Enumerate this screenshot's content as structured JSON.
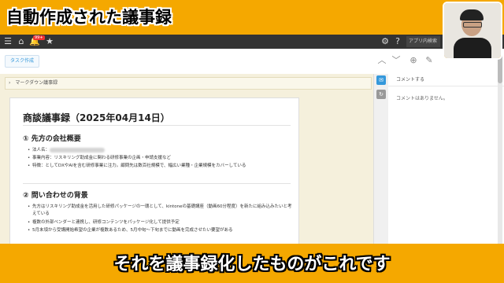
{
  "banner": {
    "title": "自動作成された議事録"
  },
  "topbar": {
    "notify_badge": "99+",
    "app_search": "アプリ内検索"
  },
  "subbar": {
    "task_tab": "タスク作成"
  },
  "breadcrumb": {
    "label": "マークダウン議事録"
  },
  "doc": {
    "title": "商談議事録（2025年04月14日）",
    "sections": [
      {
        "heading": "① 先方の会社概要",
        "bullets": [
          "法人名：",
          "事業内容：リスキリング助成金に関わる研修事業の企画・申請支援など",
          "特徴：としてDXやAIを含む研修事業に注力。顧問先は数百社規模で、幅広い業種・企業規模をカバーしている"
        ]
      },
      {
        "heading": "② 問い合わせの背景",
        "bullets": [
          "先方はリスキリング助成金を活用した研修パッケージの一環として、kintoneの基礎講座（動画60分程度）を新たに組み込みたいと考えている",
          "複数の外部ベンダーと連携し、研修コンテンツをパッケージ化して提供予定",
          "5月末頃から受講開始希望の企業が複数あるため、5月中旬〜下旬までに動画を完成させたい要望がある"
        ]
      }
    ]
  },
  "side": {
    "tab_label": "コメントする",
    "empty_text": "コメントはありません。"
  },
  "caption": {
    "text": "それを議事録化したものがこれです"
  },
  "colors": {
    "frame": "#f5a800",
    "topbar": "#333333",
    "accent": "#3498db"
  }
}
